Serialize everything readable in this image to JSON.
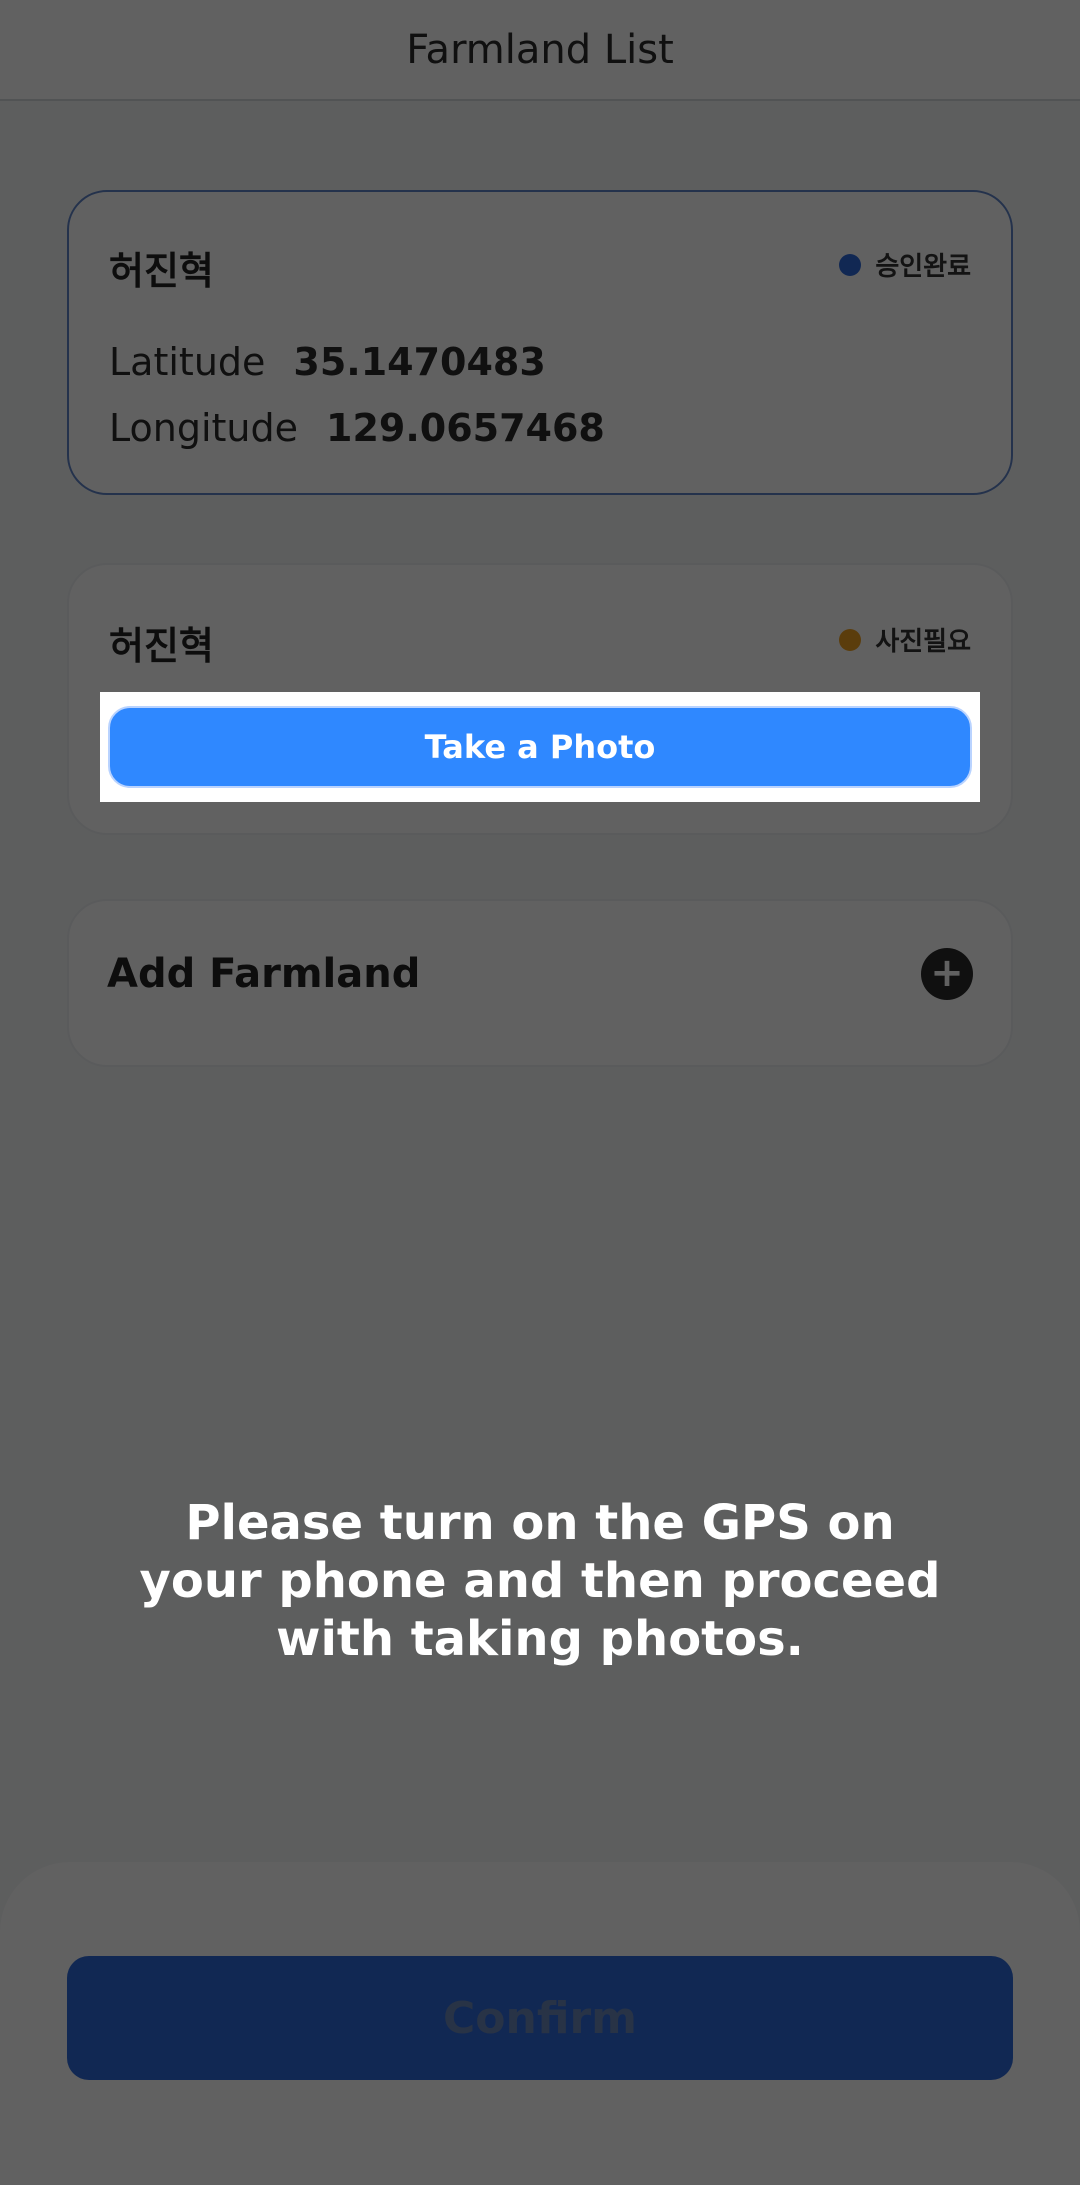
{
  "header": {
    "title": "Farmland List"
  },
  "cards": [
    {
      "name": "허진혁",
      "status": {
        "label": "승인완료",
        "color": "#2f6ad9"
      },
      "latitude_label": "Latitude",
      "latitude_value": "35.1470483",
      "longitude_label": "Longitude",
      "longitude_value": "129.0657468"
    },
    {
      "name": "허진혁",
      "status": {
        "label": "사진필요",
        "color": "#f0a020"
      },
      "button_label": "Take a Photo"
    }
  ],
  "add_farmland": {
    "label": "Add Farmland",
    "icon": "plus-circle-icon"
  },
  "overlay_message": {
    "lines": [
      "Please turn on the GPS on",
      "your phone and then proceed",
      "with taking photos."
    ]
  },
  "confirm_label": "Confirm"
}
